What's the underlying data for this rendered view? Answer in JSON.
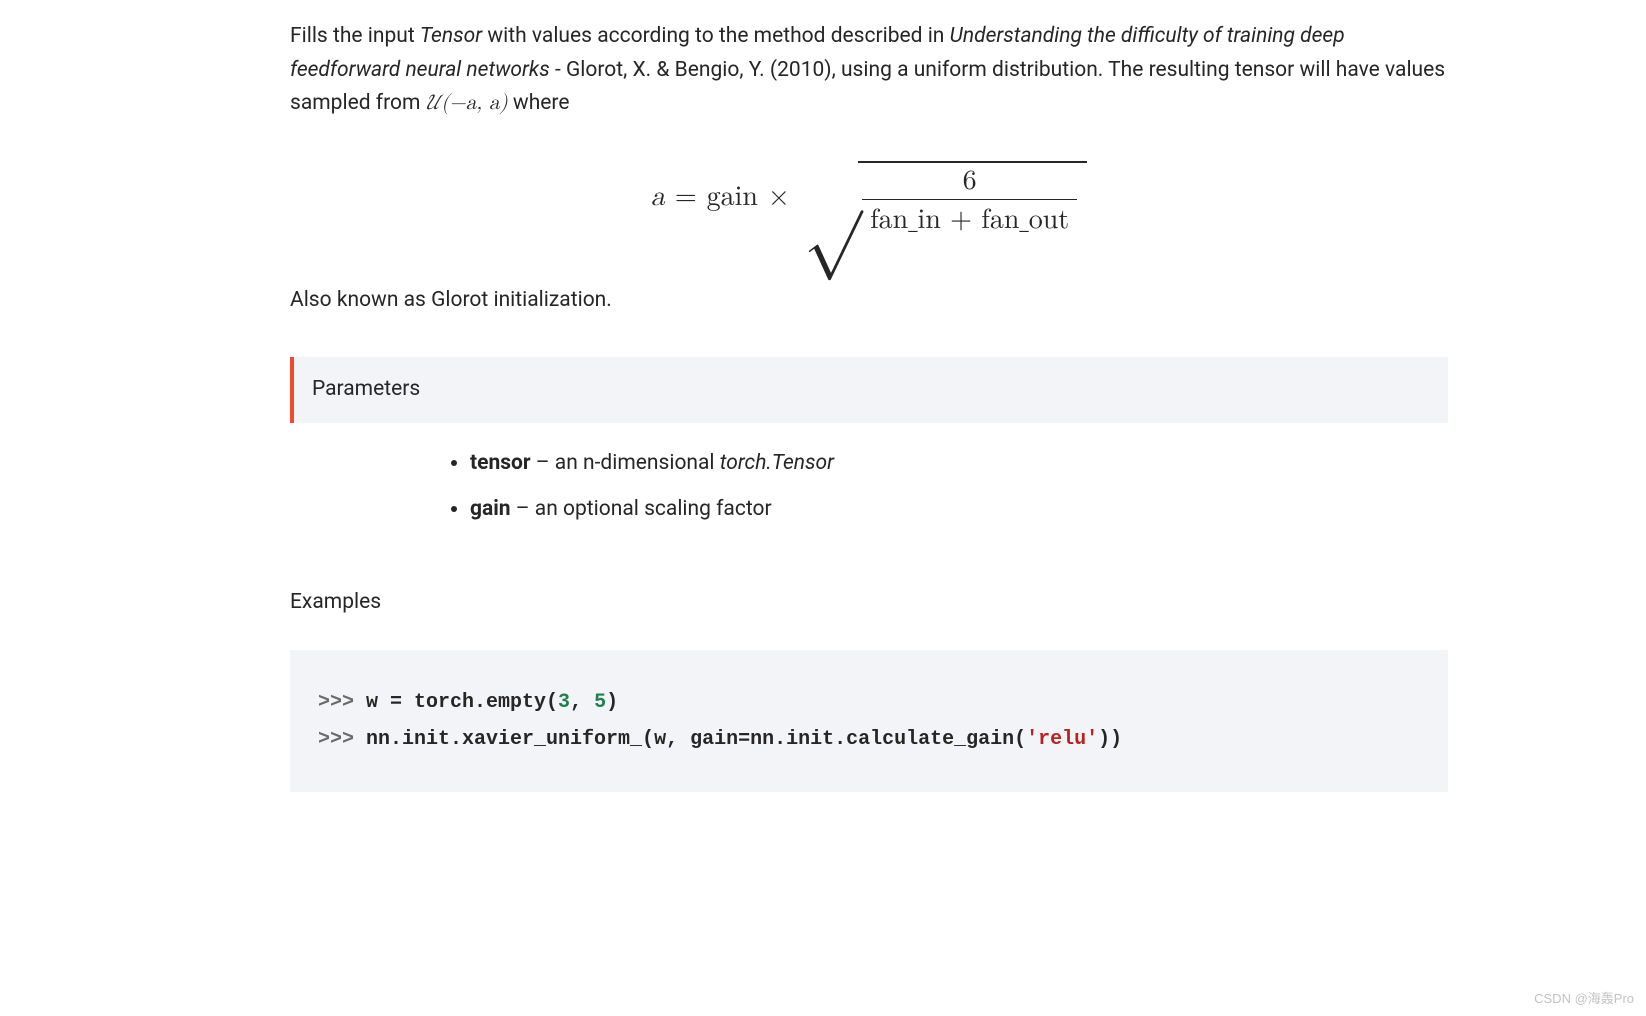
{
  "description": {
    "prefix": "Fills the input ",
    "tensor_word": "Tensor",
    "mid1": " with values according to the method described in ",
    "paper_title": "Understanding the difficulty of training deep feedforward neural networks",
    "mid2": " - Glorot, X. & Bengio, Y. (2010), using a uniform distribution. The resulting tensor will have values sampled from ",
    "dist_expr": "𝒰(−a, a)",
    "suffix": " where"
  },
  "formula": {
    "lhs": "a",
    "eq": "=",
    "gain": "gain",
    "times": "×",
    "numerator": "6",
    "denominator": "fan_in + fan_out"
  },
  "glorot_note": "Also known as Glorot initialization.",
  "parameters": {
    "header": "Parameters",
    "items": [
      {
        "name": "tensor",
        "sep": " – ",
        "desc_pre": "an n-dimensional ",
        "desc_italic": "torch.Tensor",
        "desc_post": ""
      },
      {
        "name": "gain",
        "sep": " – ",
        "desc_pre": "an optional scaling factor",
        "desc_italic": "",
        "desc_post": ""
      }
    ]
  },
  "examples": {
    "heading": "Examples",
    "code": {
      "line1": {
        "prompt": ">>> ",
        "p1": "w = torch.empty(",
        "n1": "3",
        "p2": ", ",
        "n2": "5",
        "p3": ")"
      },
      "line2": {
        "prompt": ">>> ",
        "p1": "nn.init.xavier_uniform_(w, gain=nn.init.calculate_gain(",
        "s1": "'relu'",
        "p2": "))"
      }
    }
  },
  "watermark": "CSDN @海轰Pro"
}
